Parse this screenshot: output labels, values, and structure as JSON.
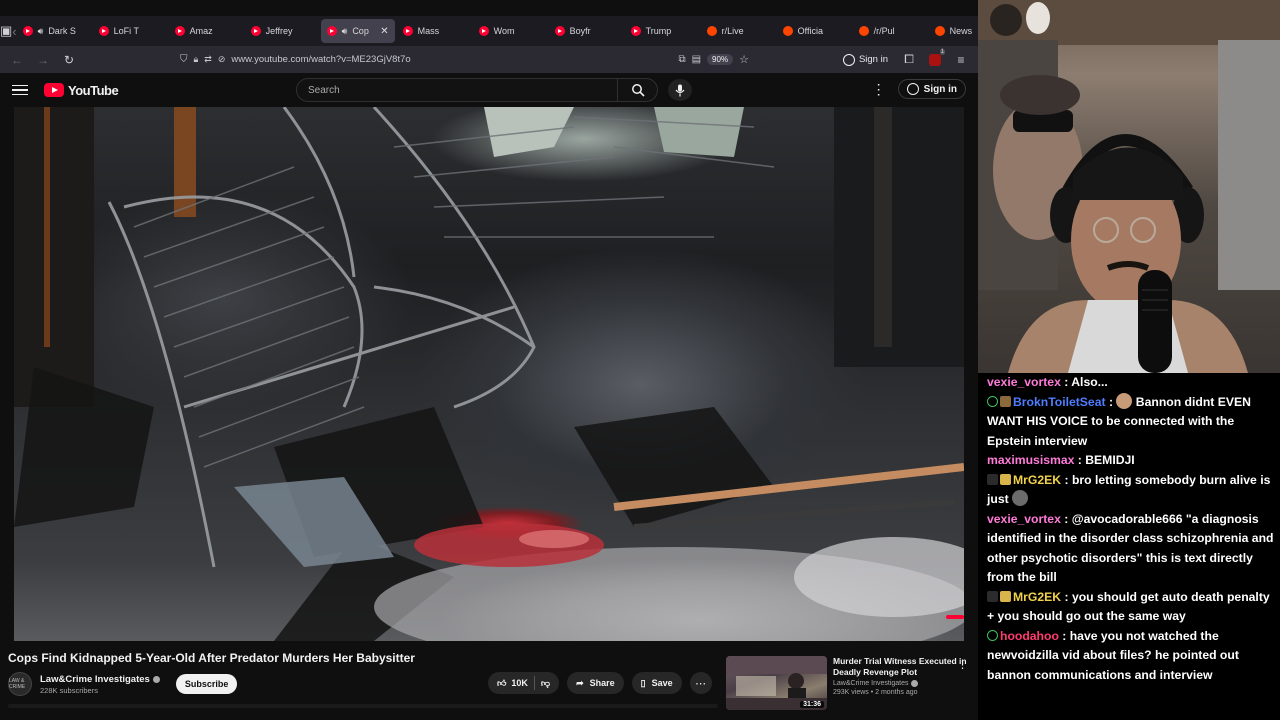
{
  "browser": {
    "tabs": [
      {
        "label": "Dark S",
        "kind": "yt",
        "audio": true
      },
      {
        "label": "LoFi T",
        "kind": "yt"
      },
      {
        "label": "Amaz",
        "kind": "yt"
      },
      {
        "label": "Jeffrey",
        "kind": "yt"
      },
      {
        "label": "Cop",
        "kind": "yt",
        "audio": true,
        "active": true
      },
      {
        "label": "Mass",
        "kind": "yt"
      },
      {
        "label": "Wom",
        "kind": "yt"
      },
      {
        "label": "Boyfr",
        "kind": "yt"
      },
      {
        "label": "Trump",
        "kind": "yt"
      },
      {
        "label": "r/Live",
        "kind": "reddit"
      },
      {
        "label": "Officia",
        "kind": "reddit"
      },
      {
        "label": "/r/Pul",
        "kind": "reddit"
      },
      {
        "label": "News",
        "kind": "reddit"
      }
    ],
    "url": "www.youtube.com/watch?v=ME23GjV8t7o",
    "zoom": "90%",
    "sign_in": "Sign in",
    "notification_count": "1"
  },
  "youtube": {
    "logo_text": "YouTube",
    "search_placeholder": "Search",
    "sign_in": "Sign in",
    "video_title": "Cops Find Kidnapped 5-Year-Old After Predator Murders Her Babysitter",
    "channel_name": "Law&Crime Investigates",
    "channel_subs": "228K subscribers",
    "channel_avatar_text": "LAW & CRIME",
    "subscribe_label": "Subscribe",
    "like_count": "10K",
    "share_label": "Share",
    "save_label": "Save",
    "recommendation": {
      "title": "Murder Trial Witness Executed in Deadly Revenge Plot",
      "channel": "Law&Crime Investigates",
      "stats": "293K views • 2 months ago",
      "duration": "31:36"
    }
  },
  "chat": {
    "messages": [
      {
        "user": "vexie_vortex",
        "color": "#ff7ad9",
        "badges": [],
        "text": "Also..."
      },
      {
        "user": "BroknToiletSeat",
        "color": "#4e7dff",
        "badges": [
          "person-b",
          "tool"
        ],
        "emote_before_text": true,
        "text": "Bannon didnt EVEN WANT HIS VOICE to be connected with the Epstein interview"
      },
      {
        "user": "maximusismax",
        "color": "#ff7ad9",
        "badges": [],
        "text": "BEMIDJI"
      },
      {
        "user": "MrG2EK",
        "color": "#f2d24a",
        "badges": [
          "dark",
          "gift"
        ],
        "text": "bro letting somebody burn alive is just",
        "emote_after_text": true
      },
      {
        "user": "vexie_vortex",
        "color": "#ff7ad9",
        "badges": [],
        "text": "@avocadorable666 \"a diagnosis identified in the disorder class schizophrenia and other psychotic disorders\" this is text directly from the bill"
      },
      {
        "user": "MrG2EK",
        "color": "#f2d24a",
        "badges": [
          "dark",
          "gift"
        ],
        "text": "you should get auto death penalty + you should go out the same way"
      },
      {
        "user": "hoodahoo",
        "color": "#ff3b6e",
        "badges": [
          "person-b"
        ],
        "text": "have you not watched the newvoidzilla vid about files? he pointed out bannon communications and interview"
      }
    ]
  }
}
